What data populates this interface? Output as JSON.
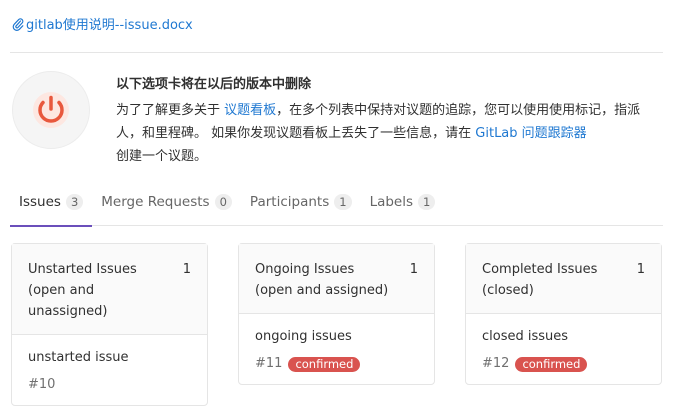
{
  "attachment": {
    "icon": "paperclip-icon",
    "filename": "gitlab使用说明--issue.docx"
  },
  "banner": {
    "icon": "power-icon",
    "title": "以下选项卡将在以后的版本中删除",
    "text_1": "为了了解更多关于",
    "link_boards": "议题看板",
    "text_2": "，在多个列表中保持对议题的追踪，您可以使用使用标记，指派人，和里程碑。 如果你发现议题看板上丢失了一些信息，请在",
    "link_tracker": "GitLab 问题跟踪器",
    "text_3": "创建一个议题。"
  },
  "tabs": [
    {
      "label": "Issues",
      "count": "3",
      "active": true
    },
    {
      "label": "Merge Requests",
      "count": "0",
      "active": false
    },
    {
      "label": "Participants",
      "count": "1",
      "active": false
    },
    {
      "label": "Labels",
      "count": "1",
      "active": false
    }
  ],
  "columns": [
    {
      "title": "Unstarted Issues (open and unassigned)",
      "count": "1",
      "issue_title": "unstarted issue",
      "issue_ref": "#10",
      "issue_label": ""
    },
    {
      "title": "Ongoing Issues (open and assigned)",
      "count": "1",
      "issue_title": "ongoing issues",
      "issue_ref": "#11",
      "issue_label": "confirmed"
    },
    {
      "title": "Completed Issues (closed)",
      "count": "1",
      "issue_title": "closed issues",
      "issue_ref": "#12",
      "issue_label": "confirmed"
    }
  ],
  "colors": {
    "link": "#1f78d1",
    "active_tab": "#6b4fbb",
    "label": "#d9534f",
    "power": "#e8583d"
  }
}
